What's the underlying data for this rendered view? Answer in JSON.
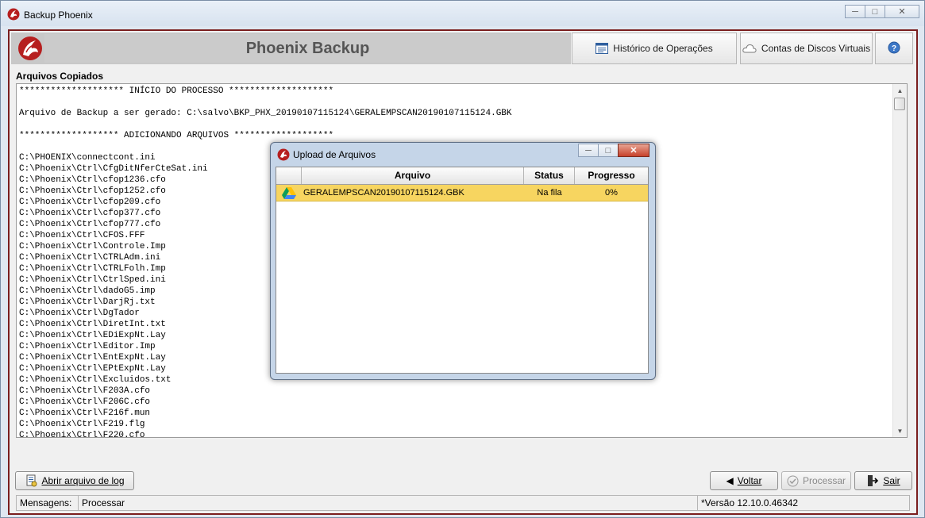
{
  "window": {
    "title": "Backup Phoenix"
  },
  "header": {
    "brand": "Phoenix Backup",
    "history_button": "Histórico de Operações",
    "cloud_button": "Contas de Discos Virtuais"
  },
  "log": {
    "label": "Arquivos Copiados",
    "lines": [
      "******************** INÍCIO DO PROCESSO ********************",
      "",
      "Arquivo de Backup a ser gerado: C:\\salvo\\BKP_PHX_20190107115124\\GERALEMPSCAN20190107115124.GBK",
      "",
      "******************* ADICIONANDO ARQUIVOS *******************",
      "",
      "C:\\PHOENIX\\connectcont.ini",
      "C:\\Phoenix\\Ctrl\\CfgDitNferCteSat.ini",
      "C:\\Phoenix\\Ctrl\\cfop1236.cfo",
      "C:\\Phoenix\\Ctrl\\cfop1252.cfo",
      "C:\\Phoenix\\Ctrl\\cfop209.cfo",
      "C:\\Phoenix\\Ctrl\\cfop377.cfo",
      "C:\\Phoenix\\Ctrl\\cfop777.cfo",
      "C:\\Phoenix\\Ctrl\\CFOS.FFF",
      "C:\\Phoenix\\Ctrl\\Controle.Imp",
      "C:\\Phoenix\\Ctrl\\CTRLAdm.ini",
      "C:\\Phoenix\\Ctrl\\CTRLFolh.Imp",
      "C:\\Phoenix\\Ctrl\\CtrlSped.ini",
      "C:\\Phoenix\\Ctrl\\dadoG5.imp",
      "C:\\Phoenix\\Ctrl\\DarjRj.txt",
      "C:\\Phoenix\\Ctrl\\DgTador",
      "C:\\Phoenix\\Ctrl\\DiretInt.txt",
      "C:\\Phoenix\\Ctrl\\EDiExpNt.Lay",
      "C:\\Phoenix\\Ctrl\\Editor.Imp",
      "C:\\Phoenix\\Ctrl\\EntExpNt.Lay",
      "C:\\Phoenix\\Ctrl\\EPtExpNt.Lay",
      "C:\\Phoenix\\Ctrl\\Excluidos.txt",
      "C:\\Phoenix\\Ctrl\\F203A.cfo",
      "C:\\Phoenix\\Ctrl\\F206C.cfo",
      "C:\\Phoenix\\Ctrl\\F216f.mun",
      "C:\\Phoenix\\Ctrl\\F219.flg",
      "C:\\Phoenix\\Ctrl\\F220.cfo"
    ]
  },
  "buttons": {
    "open_log": "Abrir arquivo de log",
    "back": "Voltar",
    "process": "Processar",
    "exit": "Sair"
  },
  "status": {
    "label": "Mensagens:",
    "message": "Processar",
    "version": "*Versão 12.10.0.46342"
  },
  "upload_dialog": {
    "title": "Upload de Arquivos",
    "columns": [
      "Arquivo",
      "Status",
      "Progresso"
    ],
    "rows": [
      {
        "file": "GERALEMPSCAN20190107115124.GBK",
        "status": "Na fila",
        "progress": "0%"
      }
    ]
  }
}
